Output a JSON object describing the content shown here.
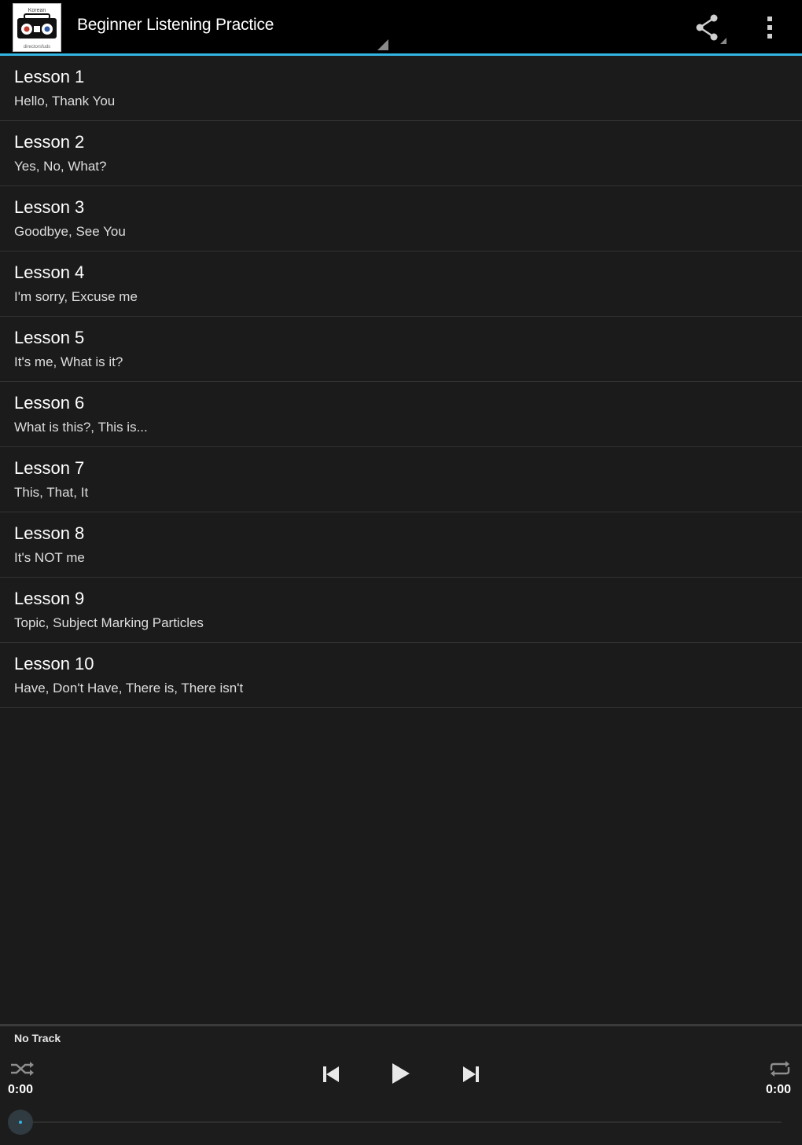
{
  "action_bar": {
    "title": "Beginner Listening Practice",
    "logo_text_top": "Korean",
    "logo_text_bottom": "directorsfuds",
    "accent_color": "#33b5e5",
    "share_icon": "share-icon",
    "overflow_icon": "overflow-menu-icon"
  },
  "lessons": [
    {
      "title": "Lesson 1",
      "subtitle": "Hello, Thank You"
    },
    {
      "title": "Lesson 2",
      "subtitle": "Yes, No, What?"
    },
    {
      "title": "Lesson 3",
      "subtitle": "Goodbye, See You"
    },
    {
      "title": "Lesson 4",
      "subtitle": "I'm sorry, Excuse me"
    },
    {
      "title": "Lesson 5",
      "subtitle": "It's me, What is it?"
    },
    {
      "title": "Lesson 6",
      "subtitle": "What is this?, This is..."
    },
    {
      "title": "Lesson 7",
      "subtitle": "This, That, It"
    },
    {
      "title": "Lesson 8",
      "subtitle": "It's NOT me"
    },
    {
      "title": "Lesson 9",
      "subtitle": "Topic, Subject Marking Particles"
    },
    {
      "title": "Lesson 10",
      "subtitle": "Have, Don't Have, There is, There isn't"
    }
  ],
  "player": {
    "track_name": "No Track",
    "elapsed": "0:00",
    "duration": "0:00",
    "progress": 0,
    "icons": [
      "shuffle-icon",
      "previous-icon",
      "play-icon",
      "next-icon",
      "repeat-icon"
    ]
  }
}
